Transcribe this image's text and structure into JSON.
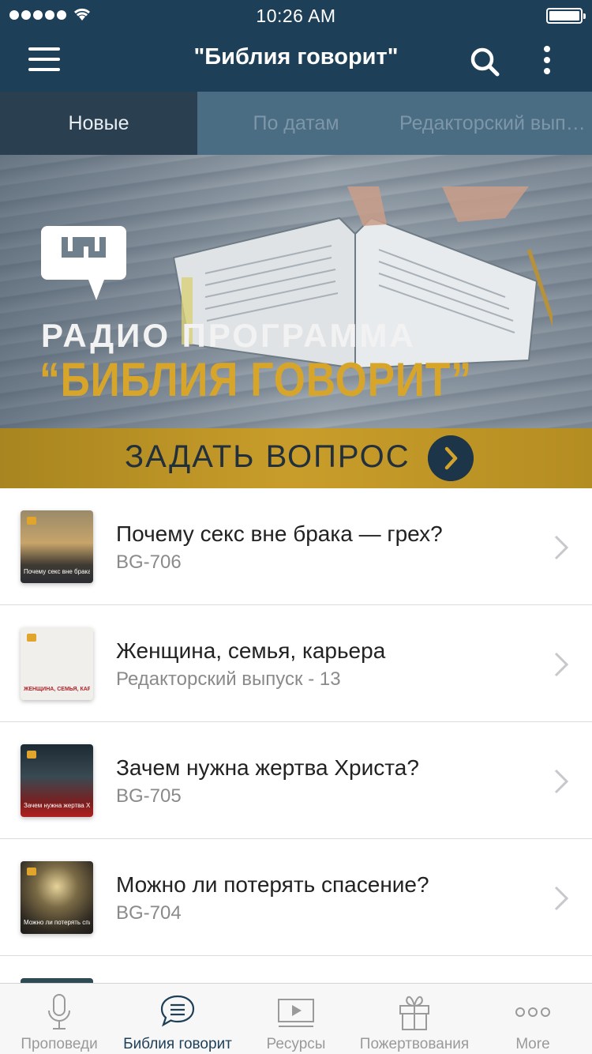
{
  "status_bar": {
    "time": "10:26 AM"
  },
  "nav": {
    "title": "\"Библия говорит\""
  },
  "tabs": [
    {
      "label": "Новые",
      "active": true
    },
    {
      "label": "По датам",
      "active": false
    },
    {
      "label": "Редакторский выпуск",
      "active": false
    }
  ],
  "banner": {
    "line1": "РАДИО ПРОГРАММА",
    "line2": "“БИБЛИЯ ГОВОРИТ”",
    "ask_label": "ЗАДАТЬ ВОПРОС"
  },
  "episodes": [
    {
      "title": "Почему секс вне брака — грех?",
      "subtitle": "BG-706",
      "thumb_text": "Почему секс вне брака - грех"
    },
    {
      "title": "Женщина, семья, карьера",
      "subtitle": "Редакторский выпуск - 13",
      "thumb_text": "ЖЕНЩИНА, СЕМЬЯ, КАРЬЕРА"
    },
    {
      "title": "Зачем нужна жертва Христа?",
      "subtitle": "BG-705",
      "thumb_text": "Зачем нужна жертва Христа?"
    },
    {
      "title": "Можно ли потерять спасение?",
      "subtitle": "BG-704",
      "thumb_text": "Можно ли потерять спасение?"
    }
  ],
  "tab_bar": [
    {
      "label": "Проповеди",
      "icon": "microphone-icon",
      "active": false
    },
    {
      "label": "Библия говорит",
      "icon": "chat-bubble-icon",
      "active": true
    },
    {
      "label": "Ресурсы",
      "icon": "video-play-icon",
      "active": false
    },
    {
      "label": "Пожертвования",
      "icon": "gift-icon",
      "active": false
    },
    {
      "label": "More",
      "icon": "more-dots-icon",
      "active": false
    }
  ],
  "colors": {
    "nav_bg": "#1d3f58",
    "tab_bg": "#4b6d84",
    "tab_active_bg": "#2a3f50",
    "accent_gold": "#c99d2a"
  }
}
